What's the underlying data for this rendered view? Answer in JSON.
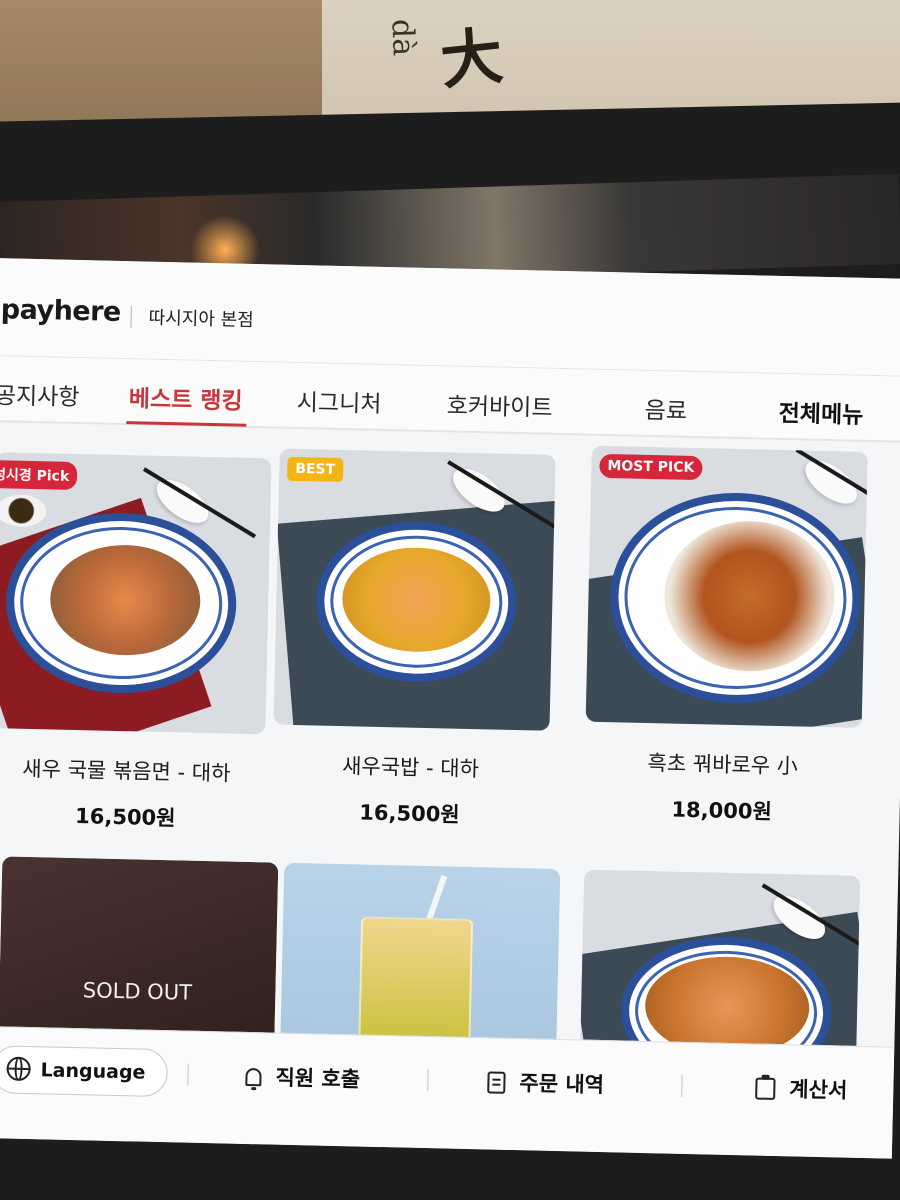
{
  "environment": {
    "sign_character": "大",
    "sign_pinyin": "dà"
  },
  "header": {
    "logo": "payhere",
    "store_name": "따시지아 본점"
  },
  "tabs": [
    {
      "label": "공지사항",
      "active": false
    },
    {
      "label": "베스트 랭킹",
      "active": true
    },
    {
      "label": "시그니처",
      "active": false
    },
    {
      "label": "호커바이트",
      "active": false
    },
    {
      "label": "음료",
      "active": false
    },
    {
      "label": "전체메뉴",
      "active": false
    }
  ],
  "menu_items": [
    {
      "badge": "성시경 Pick",
      "name": "새우 국물 볶음면 - 대하",
      "price": "16,500원"
    },
    {
      "badge": "BEST",
      "name": "새우국밥 - 대하",
      "price": "16,500원"
    },
    {
      "badge": "MOST PICK",
      "name": "흑초 꿔바로우 小",
      "price": "18,000원"
    },
    {
      "badge": "",
      "status": "SOLD OUT",
      "name": "",
      "price": ""
    },
    {
      "badge": "",
      "name": "",
      "price": ""
    },
    {
      "badge": "",
      "name": "",
      "price": ""
    }
  ],
  "bottom_bar": {
    "language_label": "Language",
    "call_staff_label": "직원 호출",
    "order_history_label": "주문 내역",
    "bill_label": "계산서"
  },
  "colors": {
    "accent": "#c8363b",
    "best_badge": "#f2b514",
    "most_pick_badge": "#d6273a",
    "plate_rim": "#2c4f9a"
  }
}
